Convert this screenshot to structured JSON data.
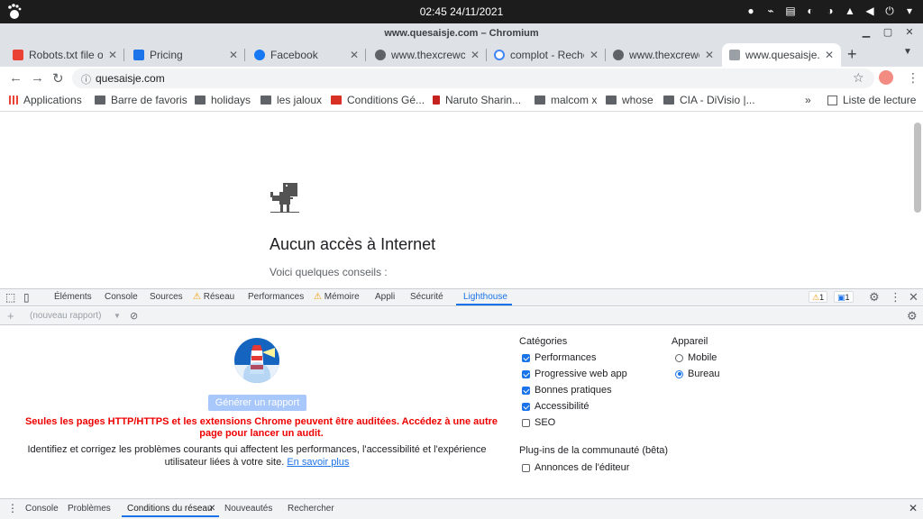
{
  "system": {
    "clock": "02:45 24/11/2021"
  },
  "window": {
    "title": "www.quesaisje.com – Chromium"
  },
  "tabs": [
    {
      "label": "Robots.txt file o",
      "icon": "gmail-icon",
      "color": "#ea4335"
    },
    {
      "label": "Pricing",
      "icon": "checkmark-logo-icon",
      "color": "#1a73e8"
    },
    {
      "label": "Facebook",
      "icon": "facebook-icon",
      "color": "#1877f2"
    },
    {
      "label": "www.thexcrewc",
      "icon": "globe-icon",
      "color": "#5f6368"
    },
    {
      "label": "complot - Reche",
      "icon": "google-icon",
      "color": "#4285f4"
    },
    {
      "label": "www.thexcrewc",
      "icon": "globe-icon",
      "color": "#5f6368"
    },
    {
      "label": "www.quesaisje.",
      "icon": "broken-page-icon",
      "color": "#9aa0a6"
    }
  ],
  "toolbar": {
    "url": "quesaisje.com"
  },
  "bookmarks": {
    "items": [
      {
        "label": "Applications"
      },
      {
        "label": "Barre de favoris"
      },
      {
        "label": "holidays"
      },
      {
        "label": "les jaloux"
      },
      {
        "label": "Conditions Gé..."
      },
      {
        "label": "Naruto Sharin..."
      },
      {
        "label": "malcom x"
      },
      {
        "label": "whose"
      },
      {
        "label": "CIA - DiVisio |..."
      }
    ],
    "more": "»",
    "reading_list": "Liste de lecture"
  },
  "page": {
    "heading": "Aucun accès à Internet",
    "tips": "Voici quelques conseils :"
  },
  "devtools": {
    "tabs": [
      "Éléments",
      "Console",
      "Sources",
      "Réseau",
      "Performances",
      "Mémoire",
      "Appli",
      "Sécurité",
      "Lighthouse"
    ],
    "warnings": "1",
    "messages": "1",
    "report_placeholder": "(nouveau rapport)"
  },
  "lighthouse": {
    "generate": "Générer un rapport",
    "error": "Seules les pages HTTP/HTTPS et les extensions Chrome peuvent être auditées. Accédez à une autre page pour lancer un audit.",
    "help": "Identifiez et corrigez les problèmes courants qui affectent les performances, l'accessibilité et l'expérience utilisateur liées à votre site.",
    "learn_more": "En savoir plus",
    "categories_title": "Catégories",
    "categories": [
      {
        "label": "Performances",
        "checked": true
      },
      {
        "label": "Progressive web app",
        "checked": true
      },
      {
        "label": "Bonnes pratiques",
        "checked": true
      },
      {
        "label": "Accessibilité",
        "checked": true
      },
      {
        "label": "SEO",
        "checked": false
      }
    ],
    "device_title": "Appareil",
    "devices": [
      {
        "label": "Mobile",
        "selected": false
      },
      {
        "label": "Bureau",
        "selected": true
      }
    ],
    "plugins_title": "Plug-ins de la communauté (bêta)",
    "plugins": [
      {
        "label": "Annonces de l'éditeur",
        "checked": false
      }
    ]
  },
  "drawer": {
    "tabs": [
      "Console",
      "Problèmes",
      "Conditions du réseau",
      "Nouveautés",
      "Rechercher"
    ]
  },
  "colors": {
    "accent": "#1a73e8",
    "error": "#ee0000",
    "warning": "#f29900"
  }
}
